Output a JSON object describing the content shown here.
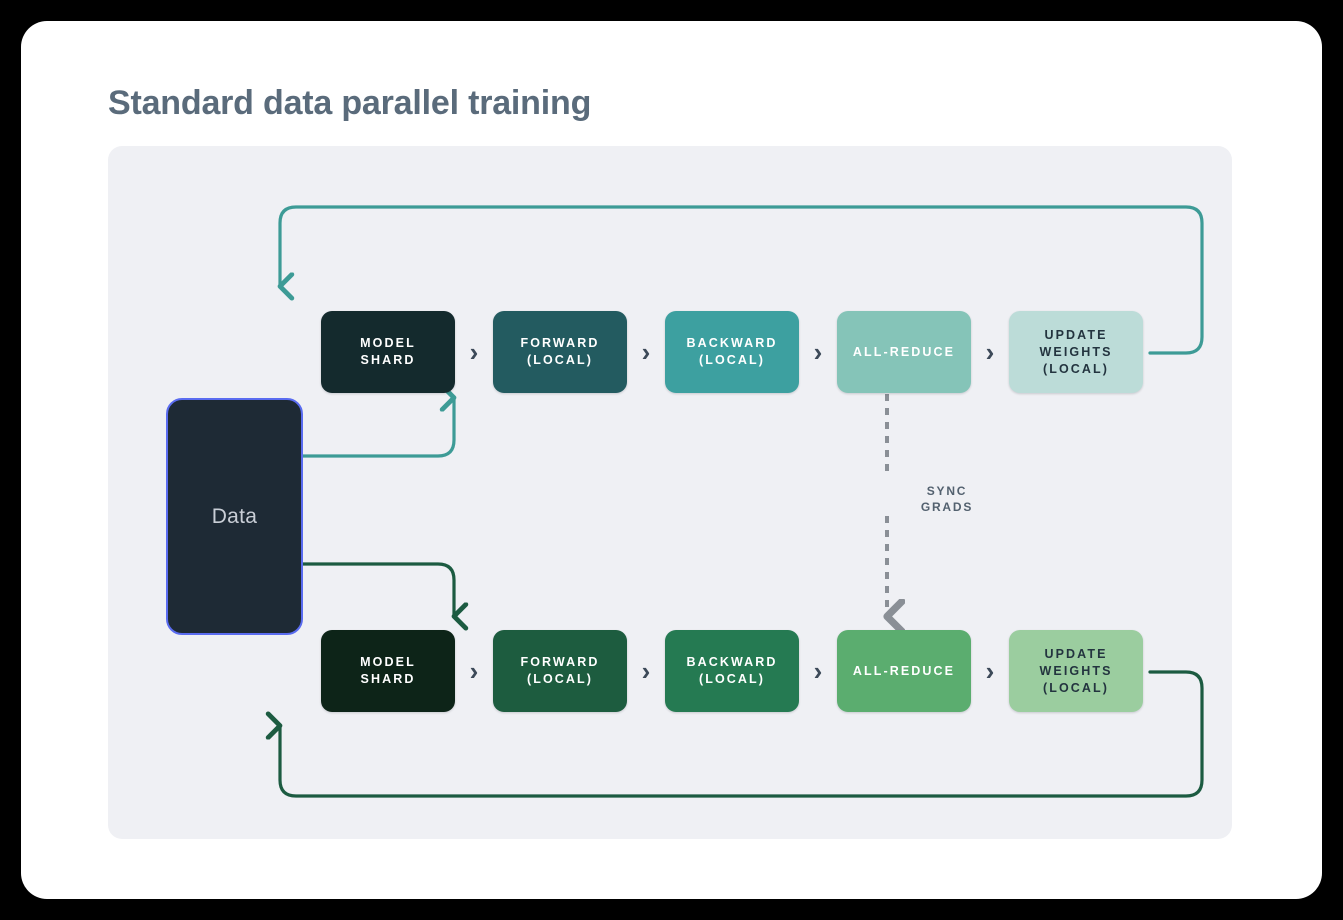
{
  "page": {
    "title": "Standard data parallel training"
  },
  "colors": {
    "background": "#000000",
    "card": "#ffffff",
    "panel": "#eff0f4",
    "title_text": "#5a6b7b",
    "chevron": "#3d4a59",
    "data_box_fill": "#1e2a35",
    "data_box_border": "#5a6cf0",
    "data_box_text": "#c9ced6",
    "teal_loop": "#3d9b96",
    "green_loop": "#1c5b41",
    "sync_arrow": "#8a8f96",
    "sync_text": "#53616f"
  },
  "diagram": {
    "data_node": {
      "label": "Data"
    },
    "sync": {
      "label_line1": "SYNC",
      "label_line2": "GRADS",
      "direction": "bidirectional",
      "style": "dashed"
    },
    "chevron_glyph": "›",
    "rows": [
      {
        "id": "replica-top",
        "accent": "teal",
        "loop_color": "#3d9b96",
        "nodes": [
          {
            "name": "model-shard",
            "lines": [
              "MODEL",
              "SHARD"
            ],
            "fill": "#142a2d",
            "text": "#ffffff"
          },
          {
            "name": "forward-local",
            "lines": [
              "FORWARD",
              "(LOCAL)"
            ],
            "fill": "#235b60",
            "text": "#ffffff"
          },
          {
            "name": "backward-local",
            "lines": [
              "BACKWARD",
              "(LOCAL)"
            ],
            "fill": "#3da0a0",
            "text": "#ffffff"
          },
          {
            "name": "all-reduce",
            "lines": [
              "ALL-REDUCE"
            ],
            "fill": "#85c4b8",
            "text": "#ffffff"
          },
          {
            "name": "update-weights",
            "lines": [
              "UPDATE",
              "WEIGHTS",
              "(LOCAL)"
            ],
            "fill": "#bcdcd8",
            "text": "#23343f"
          }
        ]
      },
      {
        "id": "replica-bottom",
        "accent": "green",
        "loop_color": "#1c5b41",
        "nodes": [
          {
            "name": "model-shard",
            "lines": [
              "MODEL",
              "SHARD"
            ],
            "fill": "#0d2418",
            "text": "#ffffff"
          },
          {
            "name": "forward-local",
            "lines": [
              "FORWARD",
              "(LOCAL)"
            ],
            "fill": "#1d5c3f",
            "text": "#ffffff"
          },
          {
            "name": "backward-local",
            "lines": [
              "BACKWARD",
              "(LOCAL)"
            ],
            "fill": "#257a52",
            "text": "#ffffff"
          },
          {
            "name": "all-reduce",
            "lines": [
              "ALL-REDUCE"
            ],
            "fill": "#5bad6f",
            "text": "#ffffff"
          },
          {
            "name": "update-weights",
            "lines": [
              "UPDATE",
              "WEIGHTS",
              "(LOCAL)"
            ],
            "fill": "#9bcd9f",
            "text": "#23343f"
          }
        ]
      }
    ]
  }
}
